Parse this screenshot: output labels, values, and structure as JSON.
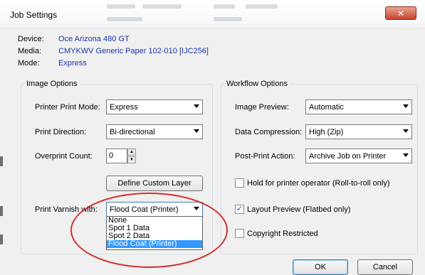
{
  "window": {
    "title": "Job Settings",
    "close_glyph": "✕"
  },
  "info": {
    "device_label": "Device:",
    "device_value": "Oce Arizona 480 GT",
    "media_label": "Media:",
    "media_value": "CMYKWV Generic Paper 102-010 [IJC256]",
    "mode_label": "Mode:",
    "mode_value": "Express"
  },
  "image_options": {
    "title": "Image Options",
    "print_mode_label": "Printer Print Mode:",
    "print_mode_value": "Express",
    "direction_label": "Print Direction:",
    "direction_value": "Bi-directional",
    "overprint_label": "Overprint Count:",
    "overprint_value": "0",
    "custom_layer_button": "Define Custom Layer",
    "varnish_label": "Print Varnish with:",
    "varnish_value": "Flood Coat (Printer)",
    "varnish_options": [
      "None",
      "Spot 1 Data",
      "Spot 2 Data",
      "Flood Coat (Printer)"
    ],
    "varnish_selected_index": 3
  },
  "workflow_options": {
    "title": "Workflow Options",
    "preview_label": "Image Preview:",
    "preview_value": "Automatic",
    "compression_label": "Data Compression:",
    "compression_value": "High (Zip)",
    "post_print_label": "Post-Print Action:",
    "post_print_value": "Archive Job on Printer",
    "hold_label": "Hold for printer operator  (Roll-to-roll only)",
    "hold_checked": false,
    "layout_label": "Layout Preview  (Flatbed only)",
    "layout_checked": true,
    "copyright_label": "Copyright Restricted",
    "copyright_checked": false
  },
  "footer": {
    "ok_label": "OK",
    "cancel_label": "Cancel"
  },
  "colors": {
    "accent": "#3399ff",
    "link_blue": "#1a35a8",
    "annotation_red": "#d42f2f"
  },
  "icons": {
    "checkmark": "✓",
    "spin_up": "▲",
    "spin_down": "▼"
  }
}
